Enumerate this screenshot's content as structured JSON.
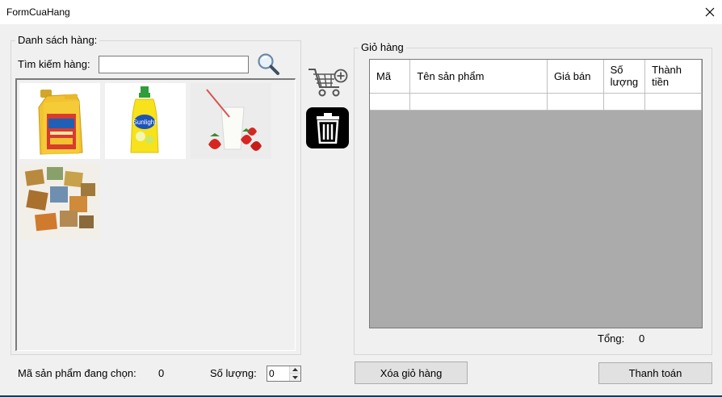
{
  "window": {
    "title": "FormCuaHang"
  },
  "product_list": {
    "group_label": "Danh sách hàng:",
    "search_label": "Tìm kiếm hàng:",
    "search_value": "",
    "products": [
      {
        "name": "cooking-oil-bottle"
      },
      {
        "name": "dish-soap-bottle"
      },
      {
        "name": "milk-strawberries"
      },
      {
        "name": "soap-bars"
      }
    ]
  },
  "cart": {
    "group_label": "Giỏ hàng",
    "columns": [
      "Mã",
      "Tên sản phẩm",
      "Giá bán",
      "Số lượng",
      "Thành tiền"
    ],
    "total_label": "Tổng:",
    "total_value": "0"
  },
  "footer": {
    "selected_label": "Mã sản phẩm đang chọn:",
    "selected_value": "0",
    "quantity_label": "Số lượng:",
    "quantity_value": "0",
    "clear_cart_button": "Xóa giỏ hàng",
    "checkout_button": "Thanh toán"
  },
  "icons": {
    "close": "close-icon",
    "search": "search-icon",
    "add_to_cart": "cart-add-icon",
    "delete": "trash-icon"
  },
  "colors": {
    "grid_background": "#ababab",
    "window_background": "#f0f0f0",
    "trash_background": "#000000"
  }
}
